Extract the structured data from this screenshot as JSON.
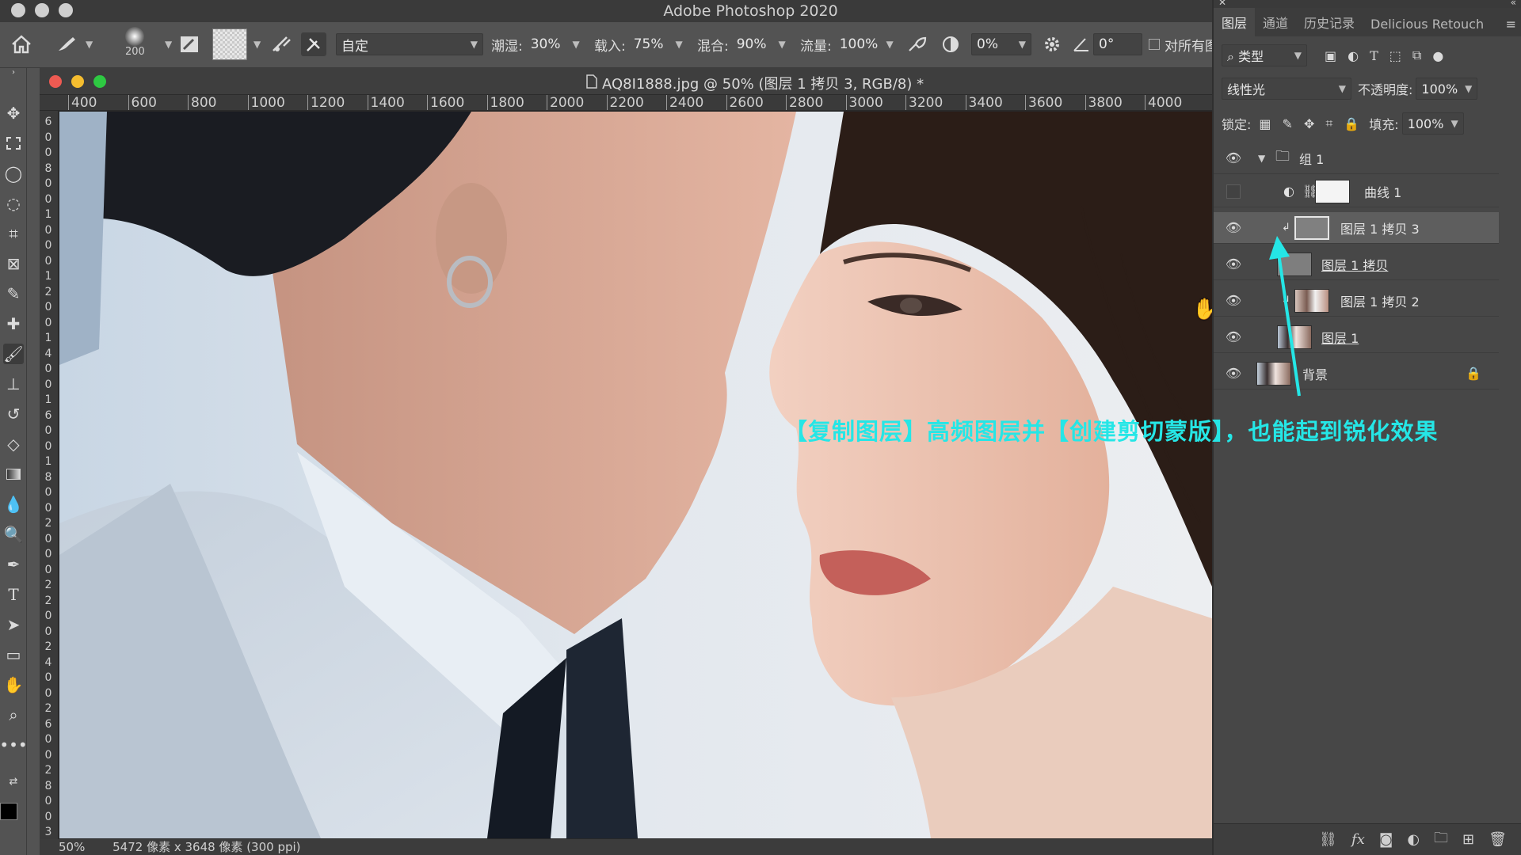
{
  "app": {
    "title": "Adobe Photoshop 2020"
  },
  "options_bar": {
    "brush_size": "200",
    "preset": "自定",
    "wet_label": "潮湿:",
    "wet_value": "30%",
    "load_label": "载入:",
    "load_value": "75%",
    "mix_label": "混合:",
    "mix_value": "90%",
    "flow_label": "流量:",
    "flow_value": "100%",
    "smoothing_value": "0%",
    "angle_value": "0°",
    "sample_all_label": "对所有图"
  },
  "document": {
    "title": "AQ8I1888.jpg @ 50% (图层 1 拷贝 3, RGB/8) *",
    "ruler_h": [
      "400",
      "600",
      "800",
      "1000",
      "1200",
      "1400",
      "1600",
      "1800",
      "2000",
      "2200",
      "2400",
      "2600",
      "2800",
      "3000",
      "3200",
      "3400",
      "3600",
      "3800",
      "4000"
    ],
    "ruler_v": [
      "6",
      "0",
      "0",
      "8",
      "0",
      "0",
      "1",
      "0",
      "0",
      "0",
      "1",
      "2",
      "0",
      "0",
      "1",
      "4",
      "0",
      "0",
      "1",
      "6",
      "0",
      "0",
      "1",
      "8",
      "0",
      "0",
      "2",
      "0",
      "0",
      "0",
      "2",
      "2",
      "0",
      "0",
      "2",
      "4",
      "0",
      "0",
      "2",
      "6",
      "0",
      "0",
      "2",
      "8",
      "0",
      "0",
      "3"
    ],
    "zoom": "50%",
    "dimensions": "5472 像素 x 3648 像素 (300 ppi)"
  },
  "layers_panel": {
    "tabs": [
      "图层",
      "通道",
      "历史记录",
      "Delicious Retouch"
    ],
    "filter_kind": "类型",
    "blend_mode": "线性光",
    "opacity_label": "不透明度:",
    "opacity_value": "100%",
    "lock_label": "锁定:",
    "fill_label": "填充:",
    "fill_value": "100%",
    "layers": [
      {
        "name": "组 1",
        "visible": true,
        "kind": "group"
      },
      {
        "name": "曲线 1",
        "visible": false,
        "kind": "adjustment"
      },
      {
        "name": "图层 1 拷贝 3",
        "visible": true,
        "kind": "clipped-gray",
        "selected": true
      },
      {
        "name": "图层 1 拷贝",
        "visible": true,
        "kind": "gray"
      },
      {
        "name": "图层 1 拷贝 2",
        "visible": true,
        "kind": "clipped-photo"
      },
      {
        "name": "图层 1",
        "visible": true,
        "kind": "photo"
      },
      {
        "name": "背景",
        "visible": true,
        "kind": "background-locked"
      }
    ]
  },
  "annotation": "【复制图层】高频图层并【创建剪切蒙版】，也能起到锐化效果",
  "colors": {
    "annotation": "#25e6e6",
    "panel_bg": "#474747",
    "ui_bg": "#535353"
  }
}
